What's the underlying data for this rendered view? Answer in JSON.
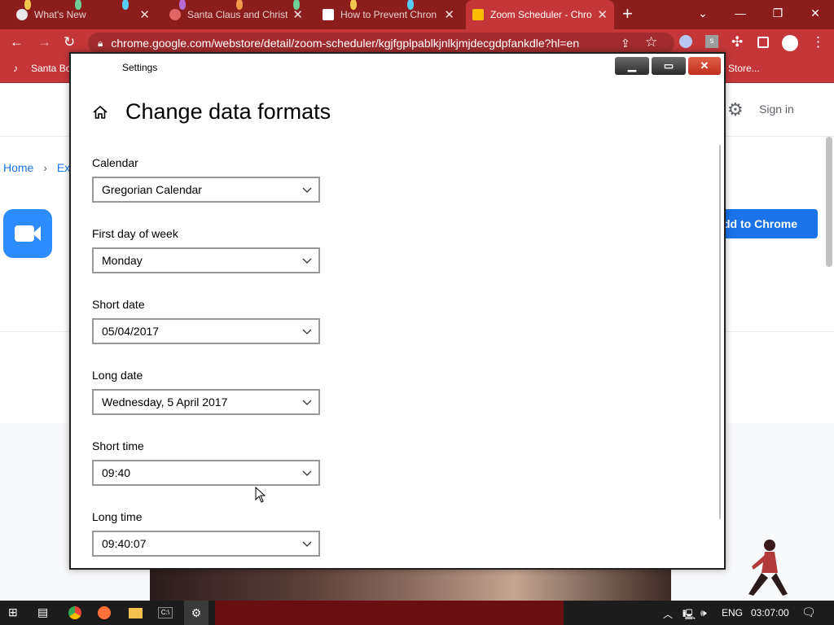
{
  "browser": {
    "tabs": [
      {
        "title": "What's New",
        "active": false
      },
      {
        "title": "Santa Claus and Christ",
        "active": false
      },
      {
        "title": "How to Prevent Chron",
        "active": false
      },
      {
        "title": "Zoom Scheduler - Chro",
        "active": true
      }
    ],
    "url": "chrome.google.com/webstore/detail/zoom-scheduler/kgjfgplpablkjnlkjmjdecgdpfankdle?hl=en",
    "bookmarks": [
      "Santa Bo",
      "Store..."
    ]
  },
  "store_page": {
    "signin": "Sign in",
    "breadcrumb_home": "Home",
    "breadcrumb_next": "Ex",
    "add_button": "dd to Chrome"
  },
  "settings": {
    "window_title": "Settings",
    "page_title": "Change data formats",
    "fields": [
      {
        "label": "Calendar",
        "value": "Gregorian Calendar"
      },
      {
        "label": "First day of week",
        "value": "Monday"
      },
      {
        "label": "Short date",
        "value": "05/04/2017"
      },
      {
        "label": "Long date",
        "value": "Wednesday, 5 April 2017"
      },
      {
        "label": "Short time",
        "value": "09:40"
      },
      {
        "label": "Long time",
        "value": "09:40:07"
      }
    ]
  },
  "taskbar": {
    "language": "ENG",
    "clock": "03:07:00"
  },
  "colors": {
    "tab_bar": "#8b1d1d",
    "toolbar": "#c4363a",
    "accent": "#1a73e8"
  }
}
